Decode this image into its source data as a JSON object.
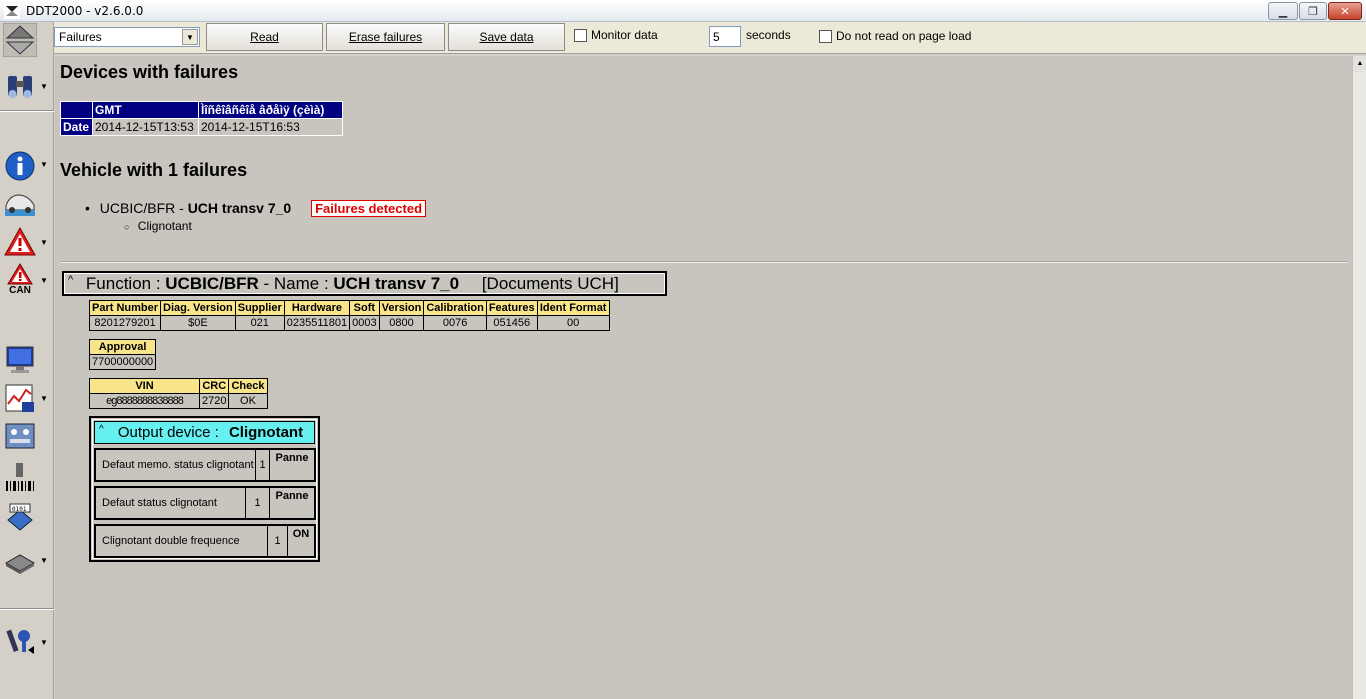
{
  "window": {
    "title": "DDT2000 - v2.6.0.0"
  },
  "toolbar": {
    "select_value": "Failures",
    "read_label": "Read",
    "erase_label": "Erase failures",
    "save_label": "Save data",
    "monitor_label": "Monitor data",
    "seconds_value": "5",
    "seconds_label": "seconds",
    "no_read_label": "Do not read on page load"
  },
  "sidebar": {
    "can_label": "CAN"
  },
  "devices": {
    "title": "Devices with failures",
    "table": {
      "header": [
        "",
        "GMT",
        "Ìîñêîâñêîå âðåìÿ (çèìà)"
      ],
      "row_label": "Date",
      "values": [
        "2014-12-15T13:53",
        "2014-12-15T16:53"
      ]
    }
  },
  "vehicle": {
    "title": "Vehicle with 1 failures",
    "ecu_code": "UCBIC/BFR - ",
    "ecu_name": "UCH transv 7_0",
    "badge": "Failures detected",
    "sub_item": "Clignotant"
  },
  "function_box": {
    "caret": "^",
    "function_label": "Function : ",
    "function_value": "UCBIC/BFR",
    "sep": " - Name : ",
    "name_value": "UCH transv 7_0",
    "docs": "[Documents UCH]"
  },
  "ident_table": {
    "headers": [
      "Part Number",
      "Diag. Version",
      "Supplier",
      "Hardware",
      "Soft",
      "Version",
      "Calibration",
      "Features",
      "Ident Format"
    ],
    "values": [
      "8201279201",
      "$0E",
      "021",
      "0235511801",
      "0003",
      "0800",
      "0076",
      "051456",
      "00"
    ]
  },
  "approval_table": {
    "header": "Approval",
    "value": "7700000000"
  },
  "vin_table": {
    "headers": [
      "VIN",
      "CRC",
      "Check"
    ],
    "values": [
      "eg8888888838888",
      "2720",
      "OK"
    ]
  },
  "output_device": {
    "caret": "^",
    "label": "Output device : ",
    "value": "Clignotant",
    "rows": [
      {
        "label": "Defaut memo. status clignotant",
        "count": "1",
        "status": "Panne"
      },
      {
        "label": "Defaut status clignotant",
        "count": "1",
        "status": "Panne"
      },
      {
        "label": "Clignotant double frequence",
        "count": "1",
        "status": "ON"
      }
    ]
  }
}
